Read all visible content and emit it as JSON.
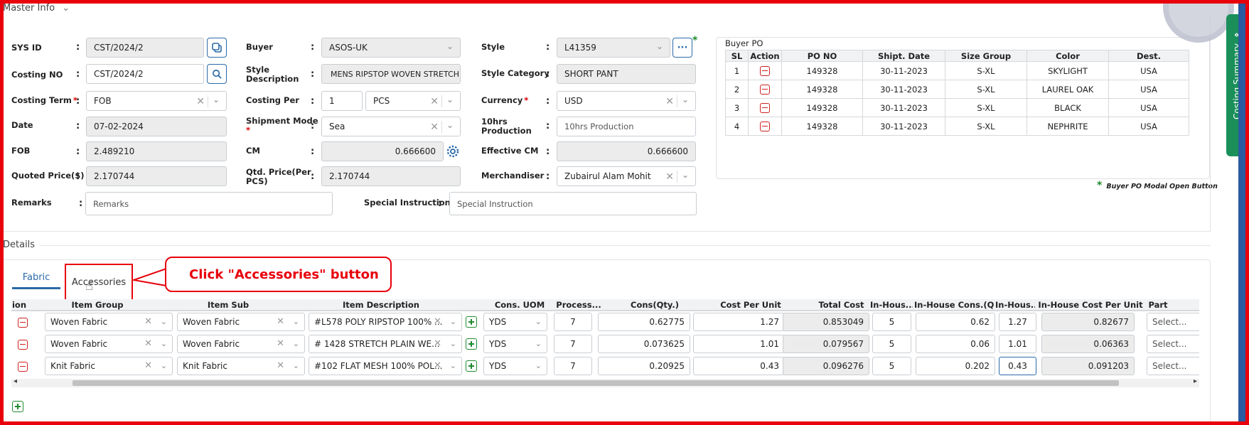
{
  "section_master": "Master Info",
  "section_details": "Details",
  "fields": {
    "sys_id": {
      "label": "SYS ID",
      "value": "CST/2024/2"
    },
    "costing_no": {
      "label": "Costing NO",
      "value": "CST/2024/2"
    },
    "costing_term": {
      "label": "Costing Term",
      "value": "FOB"
    },
    "date": {
      "label": "Date",
      "value": "07-02-2024"
    },
    "fob": {
      "label": "FOB",
      "value": "2.489210"
    },
    "quoted_price": {
      "label": "Quoted Price($)",
      "value": "2.170744"
    },
    "remarks": {
      "label": "Remarks",
      "placeholder": "Remarks"
    },
    "buyer": {
      "label": "Buyer",
      "value": "ASOS-UK"
    },
    "style_description": {
      "label_1": "Style",
      "label_2": "Description",
      "value": "MENS RIPSTOP WOVEN STRETCH T"
    },
    "costing_per": {
      "label": "Costing Per",
      "qty": "1",
      "unit": "PCS"
    },
    "shipment_mode": {
      "label": "Shipment Mode",
      "value": "Sea"
    },
    "cm": {
      "label": "CM",
      "value": "0.666600"
    },
    "qtd_price": {
      "label_1": "Qtd. Price(Per",
      "label_2": "PCS)",
      "value": "2.170744"
    },
    "special_instruction": {
      "label": "Special Instruction",
      "placeholder": "Special Instruction"
    },
    "style": {
      "label": "Style",
      "value": "L41359"
    },
    "style_category": {
      "label": "Style Category",
      "value": "SHORT PANT"
    },
    "currency": {
      "label": "Currency",
      "value": "USD"
    },
    "production": {
      "label_1": "10hrs",
      "label_2": "Production",
      "placeholder": "10hrs Production"
    },
    "effective_cm": {
      "label": "Effective CM",
      "value": "0.666600"
    },
    "merchandiser": {
      "label": "Merchandiser",
      "value": "Zubairul Alam Mohit"
    }
  },
  "required_mark": "*",
  "more_button": "···",
  "buyer_po": {
    "title": "Buyer PO",
    "headers": [
      "SL",
      "Action",
      "PO NO",
      "Shipt. Date",
      "Size Group",
      "Color",
      "Dest."
    ],
    "rows": [
      {
        "sl": "1",
        "po": "149328",
        "date": "30-11-2023",
        "size": "S-XL",
        "color": "SKYLIGHT",
        "dest": "USA"
      },
      {
        "sl": "2",
        "po": "149328",
        "date": "30-11-2023",
        "size": "S-XL",
        "color": "LAUREL OAK",
        "dest": "USA"
      },
      {
        "sl": "3",
        "po": "149328",
        "date": "30-11-2023",
        "size": "S-XL",
        "color": "BLACK",
        "dest": "USA"
      },
      {
        "sl": "4",
        "po": "149328",
        "date": "30-11-2023",
        "size": "S-XL",
        "color": "NEPHRITE",
        "dest": "USA"
      }
    ],
    "note": "Buyer PO Modal Open Button"
  },
  "tabs": {
    "fabric": "Fabric",
    "accessories": "Accessories"
  },
  "callout": "Click \"Accessories\" button",
  "side_tab": "Costing Summary",
  "grid": {
    "headers": [
      "ion",
      "Item Group",
      "Item Sub",
      "Item Description",
      "Cons. UOM",
      "Process...",
      "Cons(Qty.)",
      "Cost Per Unit",
      "Total Cost",
      "In-Hous...",
      "In-House Cons.(Q...",
      "In-Hous...",
      "In-House Cost Per Unit",
      "Part"
    ],
    "rows": [
      {
        "group": "Woven Fabric",
        "sub": "Woven Fabric",
        "desc": "#L578 POLY RIPSTOP 100% ...",
        "uom": "YDS",
        "process": "7",
        "cons": "0.62775",
        "cpu": "1.27",
        "total": "0.853049",
        "ih": "5",
        "ihcons": "0.62",
        "ihcpu_short": "1.27",
        "ihcpu": "0.82677",
        "part": "Select..."
      },
      {
        "group": "Woven Fabric",
        "sub": "Woven Fabric",
        "desc": "# 1428 STRETCH PLAIN WE...",
        "uom": "YDS",
        "process": "7",
        "cons": "0.073625",
        "cpu": "1.01",
        "total": "0.079567",
        "ih": "5",
        "ihcons": "0.06",
        "ihcpu_short": "1.01",
        "ihcpu": "0.06363",
        "part": "Select..."
      },
      {
        "group": "Knit Fabric",
        "sub": "Knit Fabric",
        "desc": "#102 FLAT MESH 100% POL...",
        "uom": "YDS",
        "process": "7",
        "cons": "0.20925",
        "cpu": "0.43",
        "total": "0.096276",
        "ih": "5",
        "ihcons": "0.202",
        "ihcpu_short": "0.43",
        "ihcpu": "0.091203",
        "part": "Select..."
      }
    ]
  },
  "colors": {
    "accent": "#2a6aa8",
    "annotation": "#e8000b",
    "side_tab": "#1a8f5a",
    "danger": "#d02020",
    "success": "#1e8a2e"
  }
}
